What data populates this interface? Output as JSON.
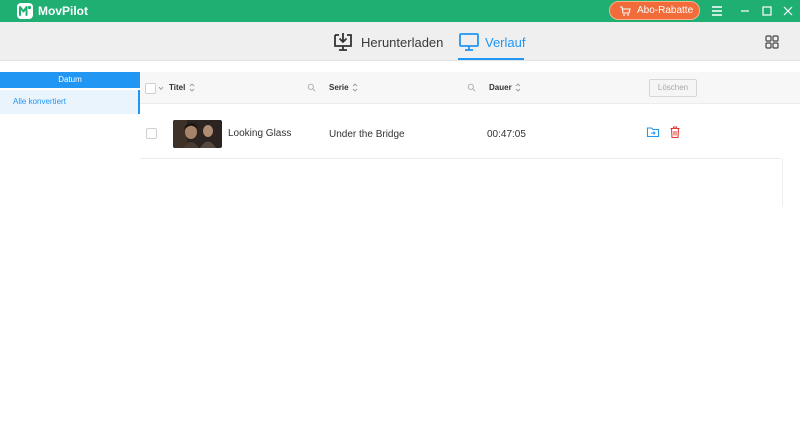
{
  "app": {
    "name": "MovPilot"
  },
  "titlebar": {
    "promo_label": "Abo-Rabatte",
    "promo_icon": "cart-icon",
    "buttons": [
      "menu-icon",
      "minimize-icon",
      "maximize-icon",
      "close-icon"
    ]
  },
  "tabs": [
    {
      "label": "Herunterladen",
      "icon": "download-monitor-icon",
      "active": false
    },
    {
      "label": "Verlauf",
      "icon": "monitor-icon",
      "active": true
    }
  ],
  "sidebar": {
    "header": "Datum",
    "items": [
      {
        "label": "Alle konvertiert",
        "selected": true
      }
    ]
  },
  "table": {
    "columns": {
      "title": "Titel",
      "series": "Serie",
      "duration": "Dauer"
    },
    "delete_label": "Löschen",
    "rows": [
      {
        "title": "Looking Glass",
        "series": "Under the Bridge",
        "duration": "00:47:05"
      }
    ]
  },
  "colors": {
    "titlebar": "#1faf73",
    "accent": "#2196f3",
    "promo": "#f26b3a",
    "trash": "#e53935"
  }
}
